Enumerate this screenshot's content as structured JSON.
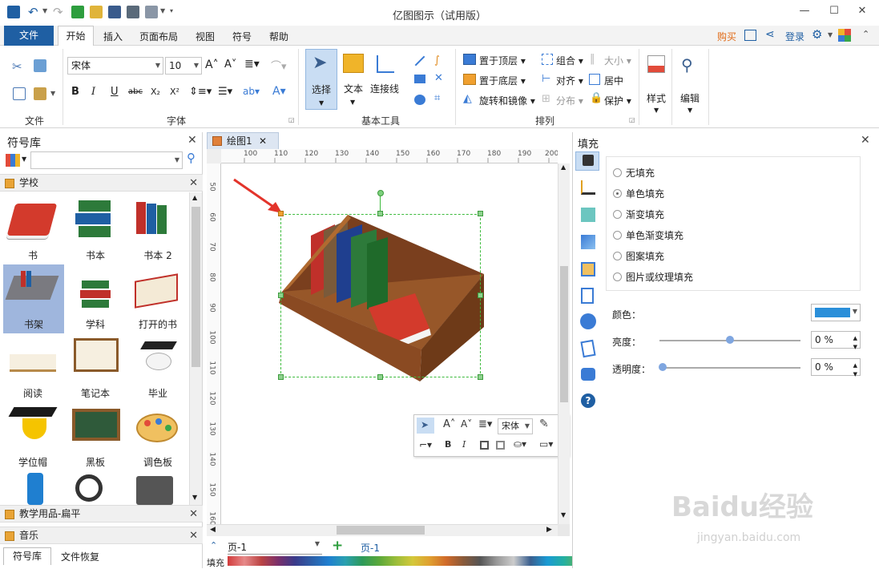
{
  "app": {
    "title": "亿图图示（试用版）"
  },
  "menu": {
    "file": "文件",
    "tabs": [
      "开始",
      "插入",
      "页面布局",
      "视图",
      "符号",
      "帮助"
    ],
    "buy": "购买",
    "login": "登录"
  },
  "ribbon": {
    "groups": {
      "file": "文件",
      "font": "字体",
      "tools": "基本工具",
      "arrange": "排列"
    },
    "font_name": "宋体",
    "font_size": "10",
    "select": "选择",
    "text": "文本",
    "connector": "连接线",
    "arrange_items": {
      "bring_top": "置于顶层",
      "send_bottom": "置于底层",
      "rotate_mirror": "旋转和镜像",
      "group": "组合",
      "align": "对齐",
      "distribute": "分布",
      "size": "大小",
      "center": "居中",
      "protect": "保护"
    },
    "style": "样式",
    "edit": "编辑"
  },
  "library": {
    "title": "符号库",
    "search_value": "",
    "section_school": "学校",
    "symbols": [
      {
        "label": "书"
      },
      {
        "label": "书本"
      },
      {
        "label": "书本 2"
      },
      {
        "label": "书架"
      },
      {
        "label": "学科"
      },
      {
        "label": "打开的书"
      },
      {
        "label": "阅读"
      },
      {
        "label": "笔记本"
      },
      {
        "label": "毕业"
      },
      {
        "label": "学位帽"
      },
      {
        "label": "黑板"
      },
      {
        "label": "调色板"
      }
    ],
    "section_teaching": "教学用品-扁平",
    "section_music": "音乐",
    "bottom_tabs": [
      "符号库",
      "文件恢复"
    ]
  },
  "document": {
    "tab": "绘图1",
    "ruler_h": [
      "100",
      "110",
      "120",
      "130",
      "140",
      "150",
      "160",
      "170",
      "180",
      "190",
      "200"
    ],
    "ruler_v": [
      "50",
      "60",
      "70",
      "80",
      "90",
      "100",
      "110",
      "120",
      "130",
      "140",
      "150",
      "160"
    ],
    "page_selector": "页-1",
    "page_tab": "页-1",
    "palette_label": "填充",
    "minitb_font": "宋体"
  },
  "fill_panel": {
    "title": "填充",
    "options": [
      "无填充",
      "单色填充",
      "渐变填充",
      "单色渐变填充",
      "图案填充",
      "图片或纹理填充"
    ],
    "selected_index": 1,
    "color_label": "颜色：",
    "color_value": "#2b8fd9",
    "brightness_label": "亮度：",
    "brightness_value": "0 %",
    "brightness_level": 0.5,
    "transparency_label": "透明度：",
    "transparency_value": "0 %",
    "transparency_level": 0
  },
  "watermark": {
    "logo": "Baidu经验",
    "url": "jingyan.baidu.com"
  },
  "colors": {
    "accent": "#1f5fa3",
    "buy": "#e06a16",
    "login": "#1f5fa3",
    "selection": "#3dbb3d"
  }
}
